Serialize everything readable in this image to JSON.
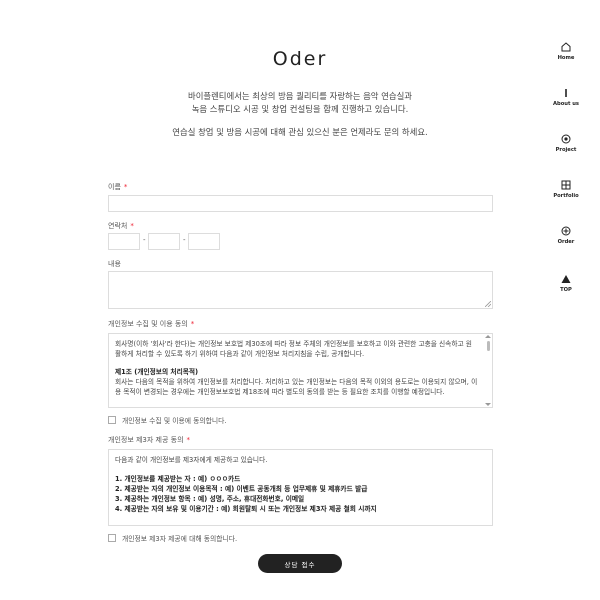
{
  "title": "Oder",
  "intro": {
    "line1": "바이플렌티에서는 최상의 방음 퀄리티를 자랑하는 음악 연습실과",
    "line2": "녹음 스튜디오 시공 및 창업 컨설팅을 함께 진행하고 있습니다.",
    "line3": "연습실 창업 및 방음 시공에 대해 관심 있으신 분은 언제라도 문의 하세요."
  },
  "form": {
    "name_label": "이름",
    "phone_label": "연락처",
    "phone_sep1": "-",
    "phone_sep2": "-",
    "content_label": "내용",
    "required_mark": "*",
    "privacy": {
      "label": "개인정보 수집 및 이용 동의",
      "intro": "회사명(이하 '회사'라 한다)는 개인정보 보호법 제30조에 따라 정보 주체의 개인정보를 보호하고 이와 관련한 고충을 신속하고 원활하게 처리할 수 있도록 하기 위하여 다음과 같이 개인정보 처리지침을 수립, 공개합니다.",
      "section_title": "제1조 (개인정보의 처리목적)",
      "section_body": "회사는 다음의 목적을 위하여 개인정보를 처리합니다. 처리하고 있는 개인정보는 다음의 목적 이외의 용도로는 이용되지 않으며, 이용 목적이 변경되는 경우에는 개인정보보호법 제18조에 따라 별도의 동의를 받는 등 필요한 조치를 이행할 예정입니다.",
      "agree": "개인정보 수집 및 이용에 동의합니다."
    },
    "third": {
      "label": "개인정보 제3자 제공 동의",
      "intro": "다음과 같이 개인정보를 제3자에게 제공하고 있습니다.",
      "item1": "1. 개인정보를 제공받는 자 : 예) ㅇㅇㅇ카드",
      "item2": "2. 제공받는 자의 개인정보 이용목적 : 예) 이벤트 공동개최 등 업무제휴 및 제휴카드 발급",
      "item3": "3. 제공하는 개인정보 항목 : 예) 성명, 주소, 휴대전화번호, 이메일",
      "item4": "4. 제공받는 자의 보유 및 이용기간 : 예) 회원탈퇴 시 또는 개인정보 제3자 제공 철회 시까지",
      "agree": "개인정보 제3자 제공에 대해 동의합니다."
    },
    "submit": "상담 접수"
  },
  "nav": [
    {
      "label": "Home",
      "icon": "home-icon"
    },
    {
      "label": "About us",
      "icon": "info-icon"
    },
    {
      "label": "Project",
      "icon": "target-icon"
    },
    {
      "label": "Portfolio",
      "icon": "grid-icon"
    },
    {
      "label": "Order",
      "icon": "plus-circle-icon"
    },
    {
      "label": "TOP",
      "icon": "arrow-up-icon"
    }
  ],
  "colors": {
    "required": "#e23333",
    "button": "#222222"
  }
}
